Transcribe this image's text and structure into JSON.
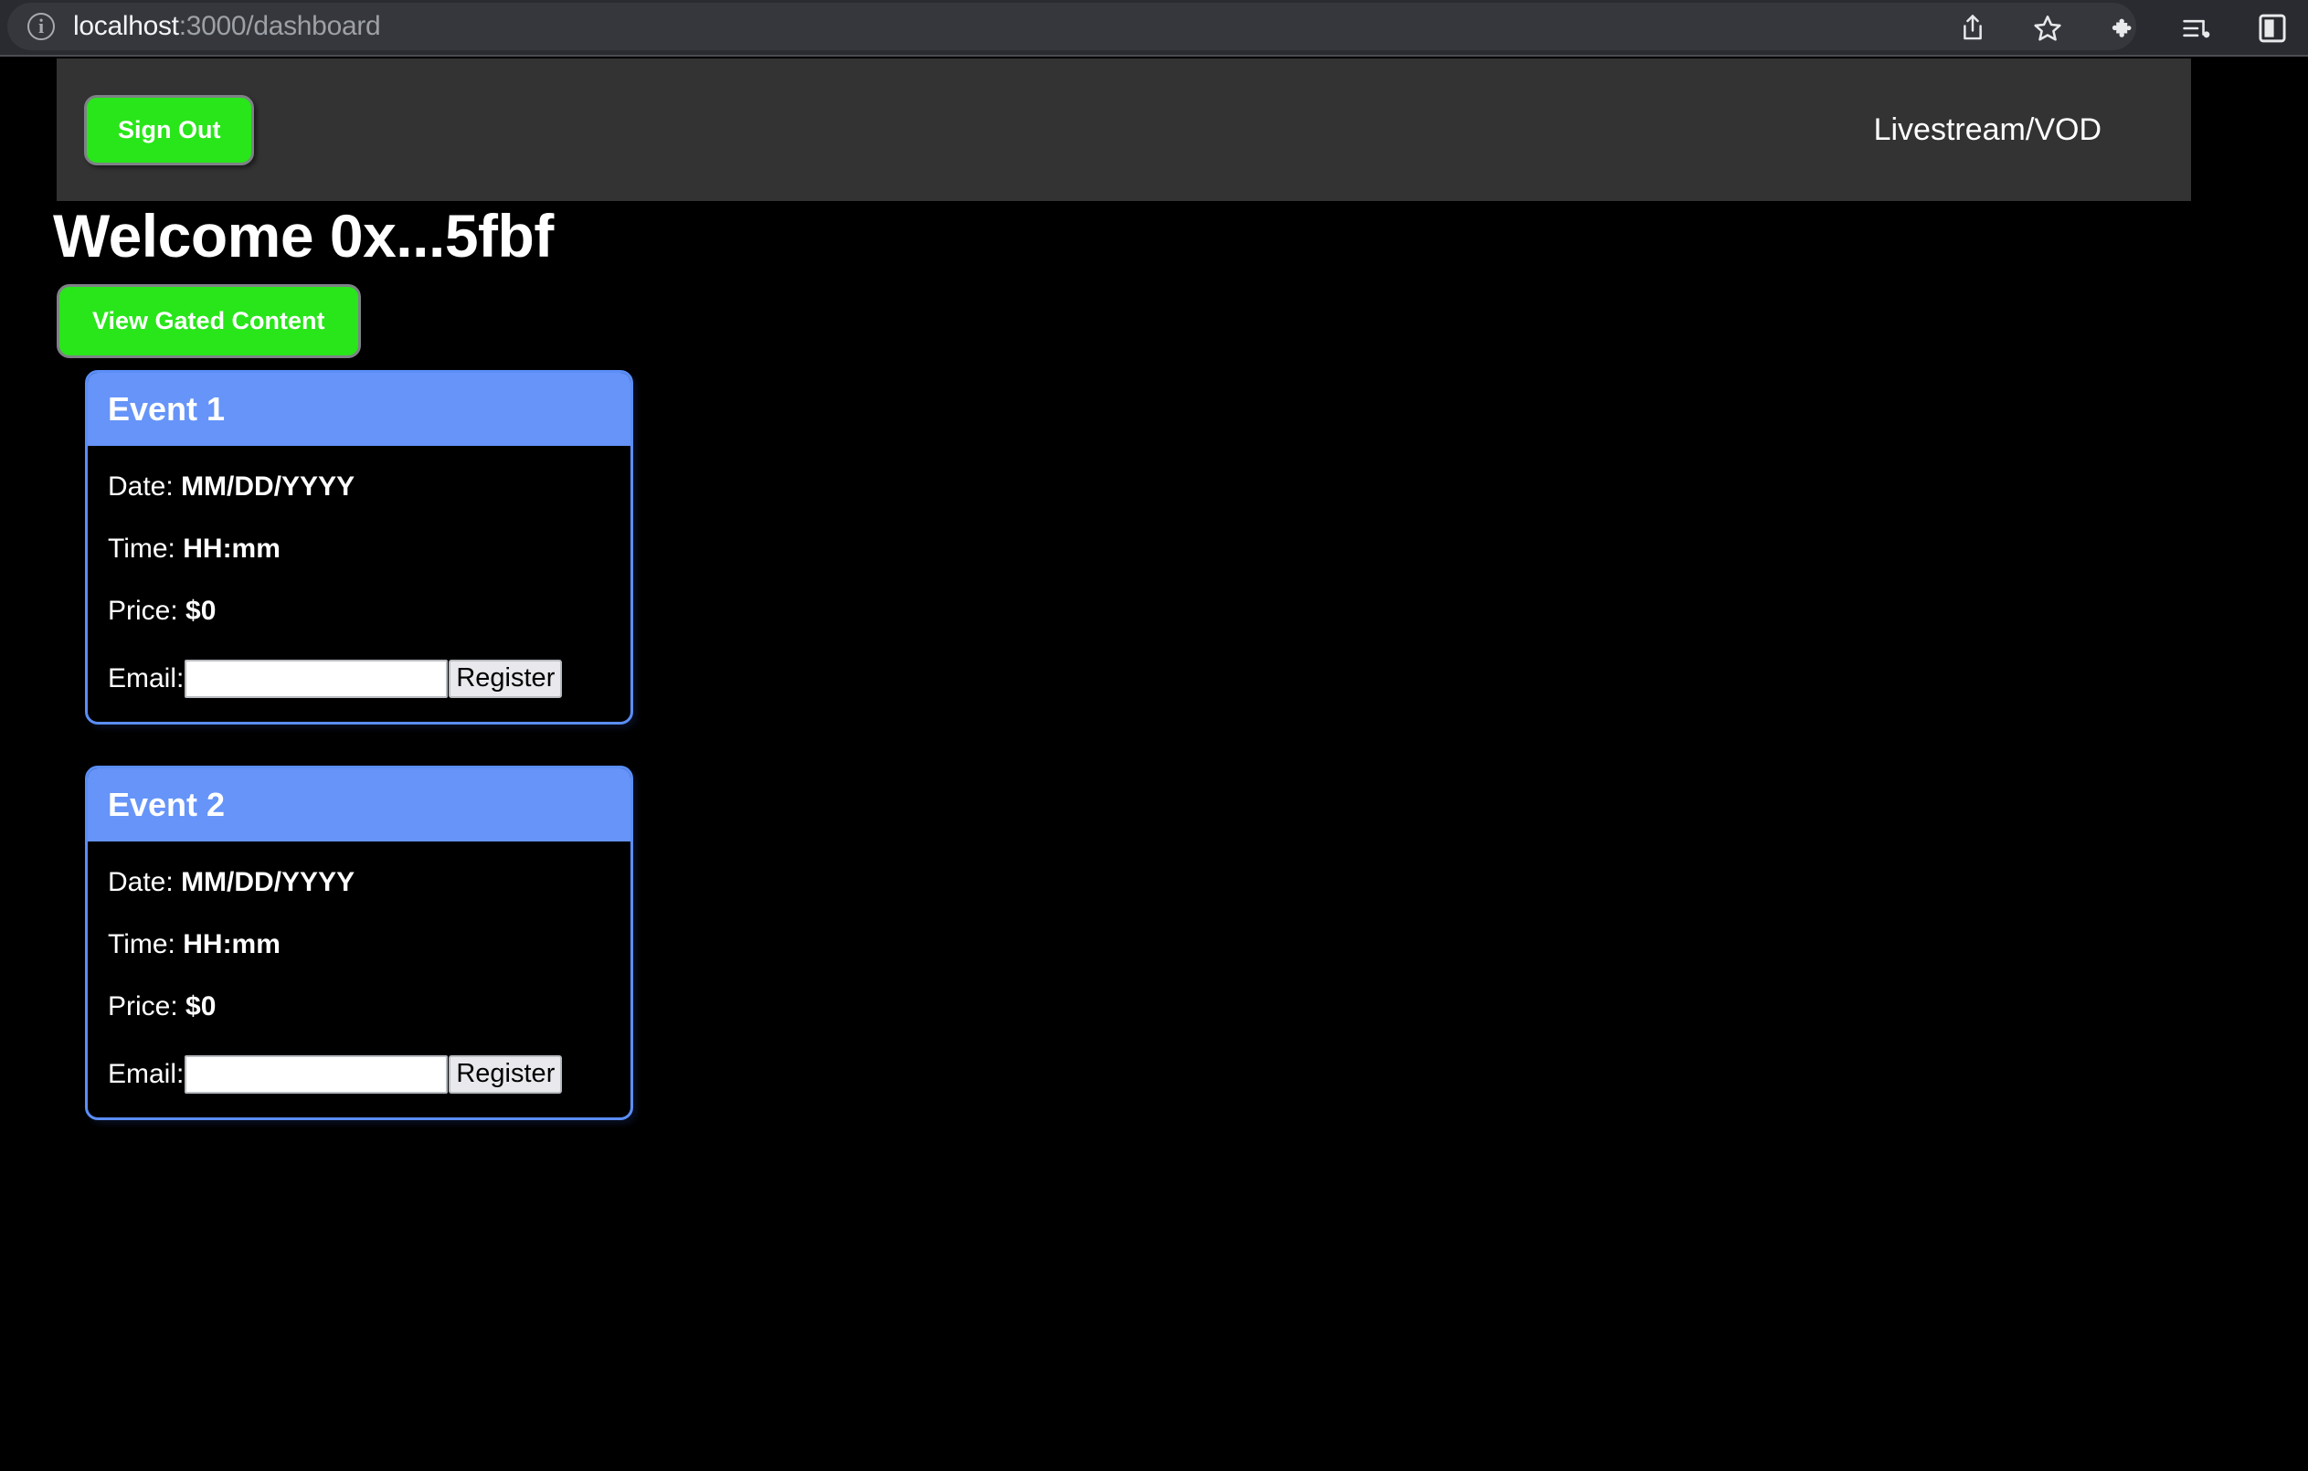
{
  "browser": {
    "url_host": "localhost",
    "url_path": ":3000/dashboard",
    "site_info_icon": "info-circle-icon",
    "actions": [
      {
        "name": "share-icon",
        "label": "Share"
      },
      {
        "name": "bookmark-star-icon",
        "label": "Bookmark"
      },
      {
        "name": "extensions-puzzle-icon",
        "label": "Extensions"
      },
      {
        "name": "media-playlist-icon",
        "label": "Media"
      },
      {
        "name": "sidebar-toggle-icon",
        "label": "Sidebar"
      }
    ]
  },
  "nav": {
    "sign_out_label": "Sign Out",
    "livestream_vod_label": "Livestream/VOD",
    "background_color": "#333333"
  },
  "page": {
    "title": "Welcome 0x...5fbf",
    "view_gated_content_label": "View Gated Content",
    "background_color": "#000000"
  },
  "theme": {
    "accent_green": "#28E619",
    "card_blue": "#6694F8",
    "card_border_blue": "#5B8EF7",
    "text_white": "#FFFFFF"
  },
  "events": [
    {
      "title": "Event 1",
      "date_label": "Date:",
      "date_value": "MM/DD/YYYY",
      "time_label": "Time:",
      "time_value": "HH:mm",
      "price_label": "Price:",
      "price_value": "$0",
      "email_label": "Email:",
      "email_value": "",
      "email_placeholder": "",
      "register_label": "Register"
    },
    {
      "title": "Event 2",
      "date_label": "Date:",
      "date_value": "MM/DD/YYYY",
      "time_label": "Time:",
      "time_value": "HH:mm",
      "price_label": "Price:",
      "price_value": "$0",
      "email_label": "Email:",
      "email_value": "",
      "email_placeholder": "",
      "register_label": "Register"
    }
  ]
}
